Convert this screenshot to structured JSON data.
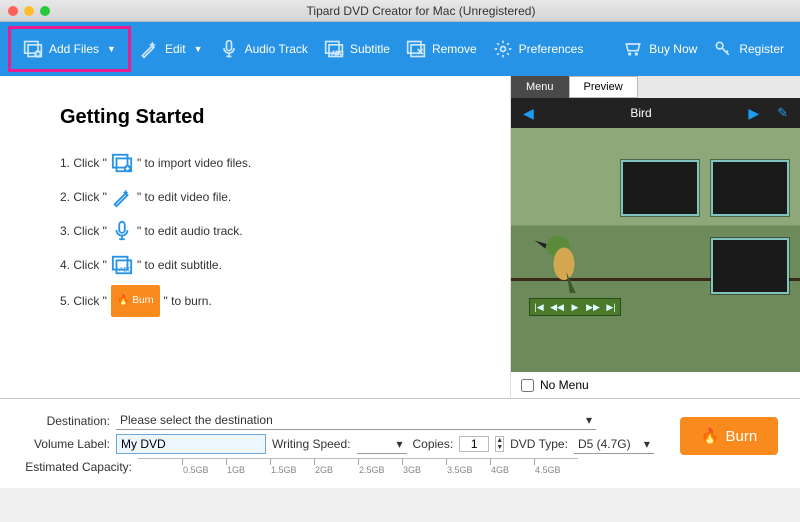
{
  "window": {
    "title": "Tipard DVD Creator for Mac (Unregistered)"
  },
  "toolbar": {
    "add_files": "Add Files",
    "edit": "Edit",
    "audio_track": "Audio Track",
    "subtitle": "Subtitle",
    "remove": "Remove",
    "preferences": "Preferences",
    "buy_now": "Buy Now",
    "register": "Register"
  },
  "getting_started": {
    "title": "Getting Started",
    "step1_a": "1. Click \"",
    "step1_b": "\" to import video files.",
    "step2_a": "2. Click \"",
    "step2_b": "\" to edit video file.",
    "step3_a": "3. Click \"",
    "step3_b": "\" to edit audio track.",
    "step4_a": "4. Click \"",
    "step4_b": "\" to edit subtitle.",
    "step5_a": "5. Click \"",
    "step5_b": "\" to burn.",
    "burn_mini": "Burn"
  },
  "preview": {
    "tab_menu": "Menu",
    "tab_preview": "Preview",
    "title": "Bird",
    "no_menu": "No Menu"
  },
  "bottom": {
    "destination_label": "Destination:",
    "destination_value": "Please select the destination",
    "volume_label_label": "Volume Label:",
    "volume_label_value": "My DVD",
    "writing_speed_label": "Writing Speed:",
    "writing_speed_value": "",
    "copies_label": "Copies:",
    "copies_value": "1",
    "dvd_type_label": "DVD Type:",
    "dvd_type_value": "D5 (4.7G)",
    "estimated_label": "Estimated Capacity:",
    "burn": "Burn",
    "ticks": [
      "0.5GB",
      "1GB",
      "1.5GB",
      "2GB",
      "2.5GB",
      "3GB",
      "3.5GB",
      "4GB",
      "4.5GB"
    ]
  }
}
